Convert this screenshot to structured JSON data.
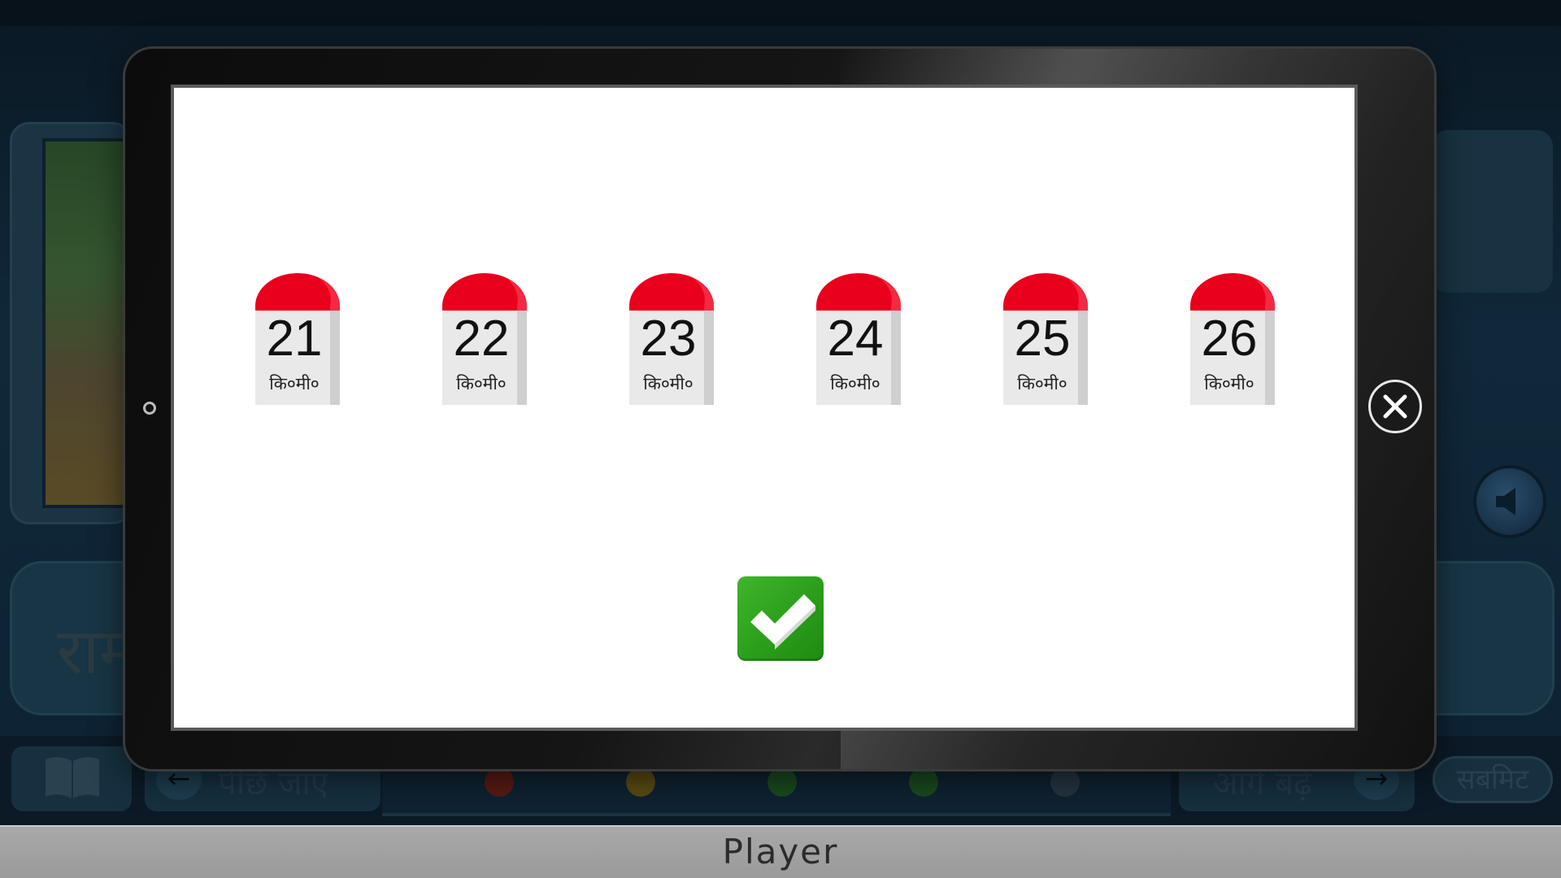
{
  "background": {
    "story_text": "राम",
    "back_label": "पीछे जाएं",
    "next_label": "आगे बढ़ें",
    "submit_label": "सबमिट",
    "progress_dot_colors": [
      "#5a1a14",
      "#5a4a14",
      "#1a4a20",
      "#1a4a20",
      "#253440"
    ]
  },
  "modal": {
    "milestones": [
      {
        "number": "21",
        "unit": "कि०मी०"
      },
      {
        "number": "22",
        "unit": "कि०मी०"
      },
      {
        "number": "23",
        "unit": "कि०मी०"
      },
      {
        "number": "24",
        "unit": "कि०मी०"
      },
      {
        "number": "25",
        "unit": "कि०मी०"
      },
      {
        "number": "26",
        "unit": "कि०मी०"
      }
    ],
    "milestone_cap_color": "#e8001d",
    "check_color": "#2f9f1f"
  },
  "player": {
    "title": "Player"
  }
}
